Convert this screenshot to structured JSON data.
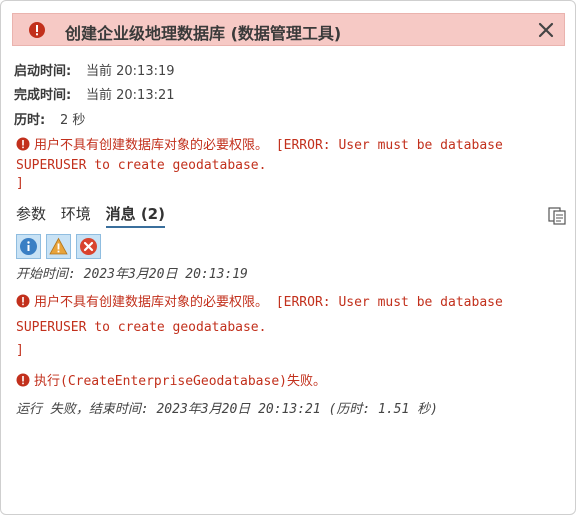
{
  "header": {
    "title": "创建企业级地理数据库 (数据管理工具)"
  },
  "info": {
    "start_label": "启动时间:",
    "start_value": "当前 20:13:19",
    "end_label": "完成时间:",
    "end_value": "当前 20:13:21",
    "duration_label": "历时:",
    "duration_value": "2 秒"
  },
  "summary_error": {
    "line1": "用户不具有创建数据库对象的必要权限。 [ERROR: User must be database",
    "line2": "SUPERUSER to create geodatabase.",
    "line3": "]"
  },
  "tabs": [
    {
      "label": "参数"
    },
    {
      "label": "环境"
    },
    {
      "label": "消息 (2)"
    }
  ],
  "filters": {
    "info": "info-filter",
    "warning": "warning-filter",
    "error": "error-filter"
  },
  "messages": {
    "start": "开始时间: 2023年3月20日 20:13:19",
    "error1_line1": "用户不具有创建数据库对象的必要权限。 [ERROR: User must be database",
    "error1_line2": "SUPERUSER to create geodatabase.",
    "error1_line3": "]",
    "error2": "执行(CreateEnterpriseGeodatabase)失败。",
    "end": "运行 失败，结束时间: 2023年3月20日 20:13:21 (历时: 1.51 秒)"
  },
  "colors": {
    "header_bg": "#f6c9c5",
    "error_red": "#c2301c",
    "tab_underline": "#3a6f9c"
  }
}
